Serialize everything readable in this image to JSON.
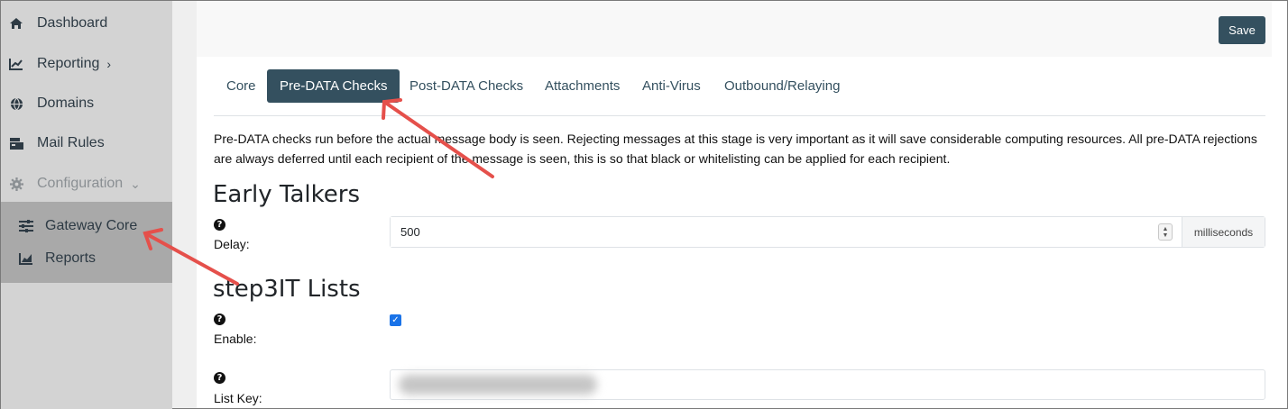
{
  "sidebar": {
    "items": [
      {
        "label": "Dashboard",
        "icon": "home-icon"
      },
      {
        "label": "Reporting",
        "icon": "chart-line-icon"
      },
      {
        "label": "Domains",
        "icon": "globe-icon"
      },
      {
        "label": "Mail Rules",
        "icon": "mail-rules-icon"
      },
      {
        "label": "Configuration",
        "icon": "gear-icon"
      }
    ],
    "submenu": [
      {
        "label": "Gateway Core",
        "icon": "sliders-icon"
      },
      {
        "label": "Reports",
        "icon": "chart-area-icon"
      }
    ]
  },
  "toolbar": {
    "save_label": "Save"
  },
  "tabs": [
    {
      "label": "Core"
    },
    {
      "label": "Pre-DATA Checks",
      "active": true
    },
    {
      "label": "Post-DATA Checks"
    },
    {
      "label": "Attachments"
    },
    {
      "label": "Anti-Virus"
    },
    {
      "label": "Outbound/Relaying"
    }
  ],
  "description": "Pre-DATA checks run before the actual message body is seen. Rejecting messages at this stage is very important as it will save considerable computing resources. All pre-DATA rejections are always deferred until each recipient of the message is seen, this is so that black or whitelisting can be applied for each recipient.",
  "early_talkers": {
    "heading": "Early Talkers",
    "delay_label": "Delay:",
    "delay_value": "500",
    "delay_unit": "milliseconds"
  },
  "lists": {
    "heading": "step3IT Lists",
    "enable_label": "Enable:",
    "enable_checked": true,
    "list_key_label": "List Key:"
  },
  "help_glyph": "?",
  "colors": {
    "sidebar_bg": "#d3d3d3",
    "submenu_bg": "#a9a9a9",
    "accent": "#34505f",
    "annotation_arrow": "#e5504b"
  }
}
